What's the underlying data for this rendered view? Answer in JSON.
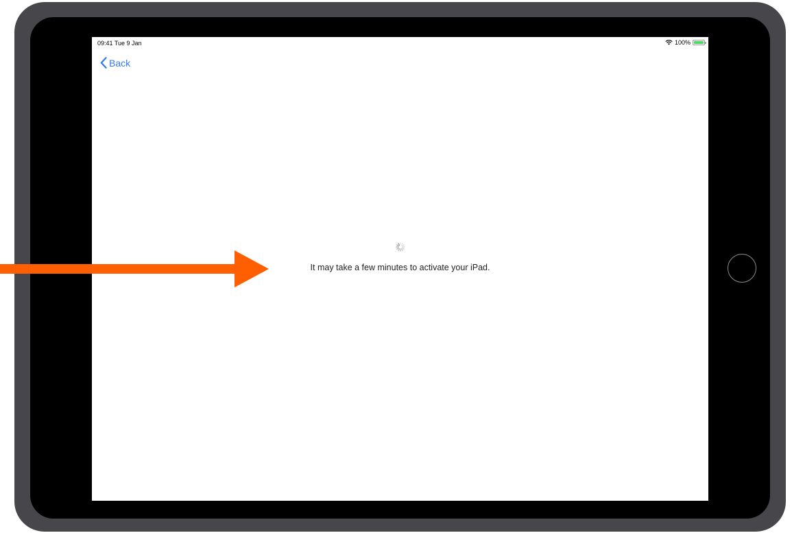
{
  "status_bar": {
    "time_date": "09:41  Tue 9 Jan",
    "battery_percent": "100%",
    "battery_level": 1.0,
    "icons": [
      "wifi-icon",
      "battery-icon"
    ]
  },
  "nav": {
    "back_label": "Back",
    "back_icon": "chevron-left-icon"
  },
  "main": {
    "loading_icon": "spinner-icon",
    "message": "It may take a few minutes to activate your iPad."
  },
  "annotation": {
    "icon": "arrow-right-icon",
    "color": "#ff5f00"
  },
  "colors": {
    "accent": "#3478f6",
    "battery": "#4cd964",
    "device_frame": "#47474b"
  }
}
